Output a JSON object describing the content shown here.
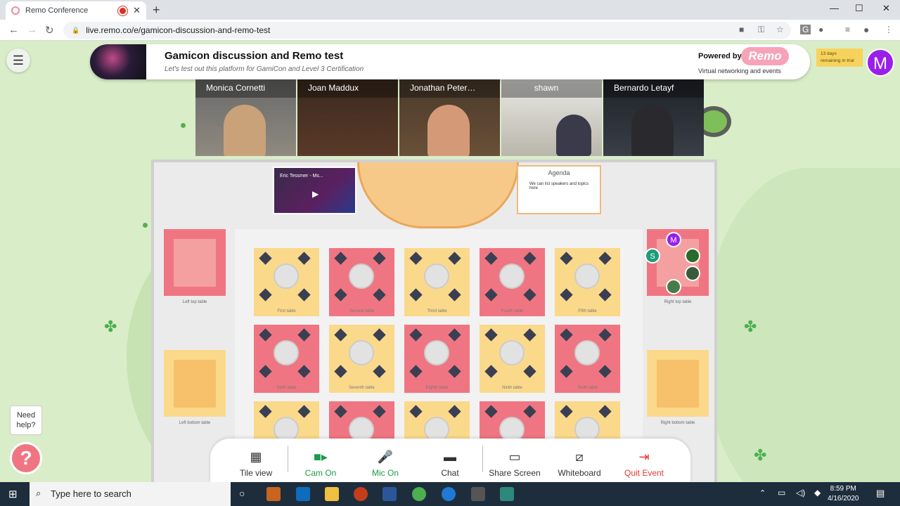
{
  "browser": {
    "tab_title": "Remo Conference",
    "url": "live.remo.co/e/gamicon-discussion-and-remo-test"
  },
  "header": {
    "title": "Gamicon discussion and Remo test",
    "subtitle": "Let's test out this platform for GamiCon and Level 3 Certification",
    "powered_by": "Powered by",
    "brand": "Remo",
    "tagline": "Virtual networking and events",
    "trial_line1": "13 days",
    "trial_line2": "remaining in trial",
    "avatar_letter": "M"
  },
  "participants": [
    {
      "name": "Monica Cornetti"
    },
    {
      "name": "Joan Maddux"
    },
    {
      "name": "Jonathan Peter…"
    },
    {
      "name": "shawn"
    },
    {
      "name": "Bernardo Letayf"
    }
  ],
  "stage": {
    "video_title": "Eric Tessmer - Ms...",
    "agenda_title": "Agenda",
    "agenda_item": "We can list speakers and topics here"
  },
  "tables": {
    "first": "First table",
    "second": "Second table",
    "third": "Third table",
    "fourth": "Fourth table",
    "fifth": "Fifth table",
    "sixth": "Sixth table",
    "seventh": "Seventh table",
    "eighth": "Eighth table",
    "ninth": "Ninth table",
    "tenth": "Tenth table",
    "left_top": "Left top table",
    "left_bottom": "Left bottom table",
    "right_top": "Right top table",
    "right_bottom": "Right bottom table"
  },
  "table_users": {
    "m": "M",
    "s": "S"
  },
  "toolbar": {
    "tile_view": "Tile view",
    "cam": "Cam On",
    "mic": "Mic On",
    "chat": "Chat",
    "share": "Share Screen",
    "whiteboard": "Whiteboard",
    "quit": "Quit Event"
  },
  "help": {
    "label_line1": "Need",
    "label_line2": "help?",
    "icon": "?"
  },
  "taskbar": {
    "search_placeholder": "Type here to search",
    "time": "8:59 PM",
    "date": "4/16/2020"
  },
  "colors": {
    "accent_pink": "#f07582",
    "accent_yellow": "#fbd98b",
    "remo_pink": "#f6a3b8",
    "avatar_purple": "#9b1fe8",
    "green": "#1d9a4a",
    "red": "#e53935"
  }
}
